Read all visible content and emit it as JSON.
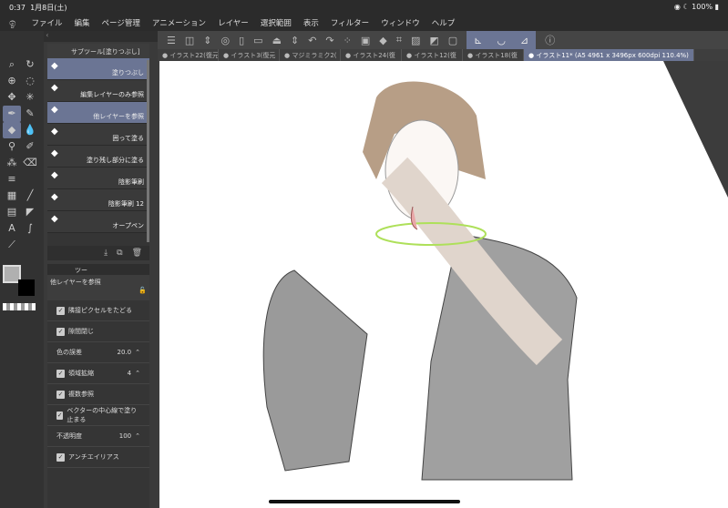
{
  "status": {
    "time": "0:37",
    "date": "1月8日(土)",
    "battery": "100%"
  },
  "menu": [
    "ファイル",
    "編集",
    "ページ管理",
    "アニメーション",
    "レイヤー",
    "選択範囲",
    "表示",
    "フィルター",
    "ウィンドウ",
    "ヘルプ"
  ],
  "tabs": [
    "イラスト22(復元",
    "イラスト3(復元",
    "マジミラミク2(",
    "イラスト24(復",
    "イラスト12(復",
    "イラスト18(復",
    "イラスト11* (A5 4961 x 3496px 600dpi 110.4%)"
  ],
  "subtool": {
    "title": "サブツール[塗りつぶし]",
    "items": [
      {
        "label": "塗りつぶし",
        "selected": true
      },
      {
        "label": "編集レイヤーのみ参照",
        "selected": false
      },
      {
        "label": "他レイヤーを参照",
        "selected": true
      },
      {
        "label": "囲って塗る",
        "selected": false
      },
      {
        "label": "塗り残し部分に塗る",
        "selected": false
      },
      {
        "label": "陰影筆刷",
        "selected": false
      },
      {
        "label": "陰影筆刷 12",
        "selected": false
      },
      {
        "label": "オープペン",
        "selected": false
      }
    ]
  },
  "props": {
    "tab": "ツー",
    "title": "他レイヤーを参照",
    "rows": [
      {
        "label": "隣接ピクセルをたどる",
        "checked": true,
        "value": ""
      },
      {
        "label": "隙間閉じ",
        "checked": true,
        "value": ""
      },
      {
        "label": "色の誤差",
        "checked": null,
        "value": "20.0"
      },
      {
        "label": "領域拡縮",
        "checked": true,
        "value": "4"
      },
      {
        "label": "複数参照",
        "checked": true,
        "value": ""
      },
      {
        "label": "ベクターの中心線で塗り止まる",
        "checked": true,
        "value": ""
      },
      {
        "label": "不透明度",
        "checked": null,
        "value": "100"
      },
      {
        "label": "アンチエイリアス",
        "checked": true,
        "value": ""
      }
    ]
  },
  "colors": {
    "accent": "#6b7594",
    "main_color": "#b0b0b0",
    "sub_color": "#000000"
  }
}
